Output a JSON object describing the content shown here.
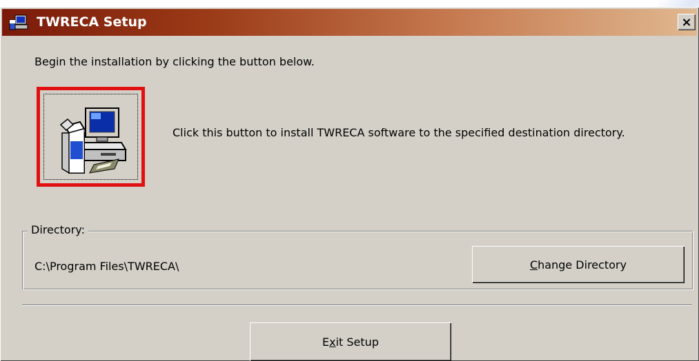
{
  "window": {
    "title": "TWRECA Setup",
    "close_label": "×",
    "colors": {
      "face": "#d4d0c8",
      "title_start": "#7a1a0a",
      "title_end": "#e0b890",
      "highlight_border": "#e01010"
    }
  },
  "main": {
    "intro_text": "Begin the installation by clicking the button below.",
    "install_button": {
      "icon": "computer-install-icon"
    },
    "install_description": "Click this button to install TWRECA software to the specified destination directory."
  },
  "directory": {
    "label": "Directory:",
    "path": "C:\\Program Files\\TWRECA\\",
    "change_button": {
      "mnemonic": "C",
      "rest": "hange Directory"
    }
  },
  "footer": {
    "exit_button": {
      "pre": "E",
      "mnemonic": "x",
      "post": "it Setup"
    }
  }
}
